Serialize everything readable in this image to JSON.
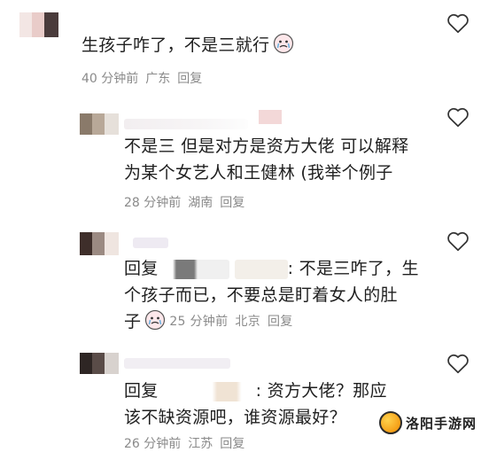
{
  "comments": [
    {
      "text": "生孩子咋了，不是三就行",
      "time": "40 分钟前",
      "location": "广东",
      "reply": "回复"
    },
    {
      "text_line1": "不是三 但是对方是资方大佬 可以解释",
      "text_line2": "为某个女艺人和王健林 (我举个例子",
      "time": "28 分钟前",
      "location": "湖南",
      "reply": "回复"
    },
    {
      "reply_prefix": "回复",
      "text_line1_tail": ": 不是三咋了，生",
      "text_line2": "个孩子而已，不要总是盯着女人的肚",
      "text_line3_start": "子",
      "time": "25 分钟前",
      "location": "北京",
      "reply": "回复"
    },
    {
      "reply_prefix": "回复",
      "text_line1_tail": ": 资方大佬？那应",
      "text_line2": "该不缺资源吧，谁资源最好？",
      "time": "26 分钟前",
      "location": "江苏",
      "reply": "回复"
    }
  ],
  "watermark": {
    "text": "洛阳手游网"
  },
  "icons": {
    "like": "heart-outline-icon",
    "emoji": "crying-face-emoji"
  },
  "colors": {
    "text": "#1f1f1f",
    "meta": "#8a8a8a",
    "heart": "#333333"
  }
}
